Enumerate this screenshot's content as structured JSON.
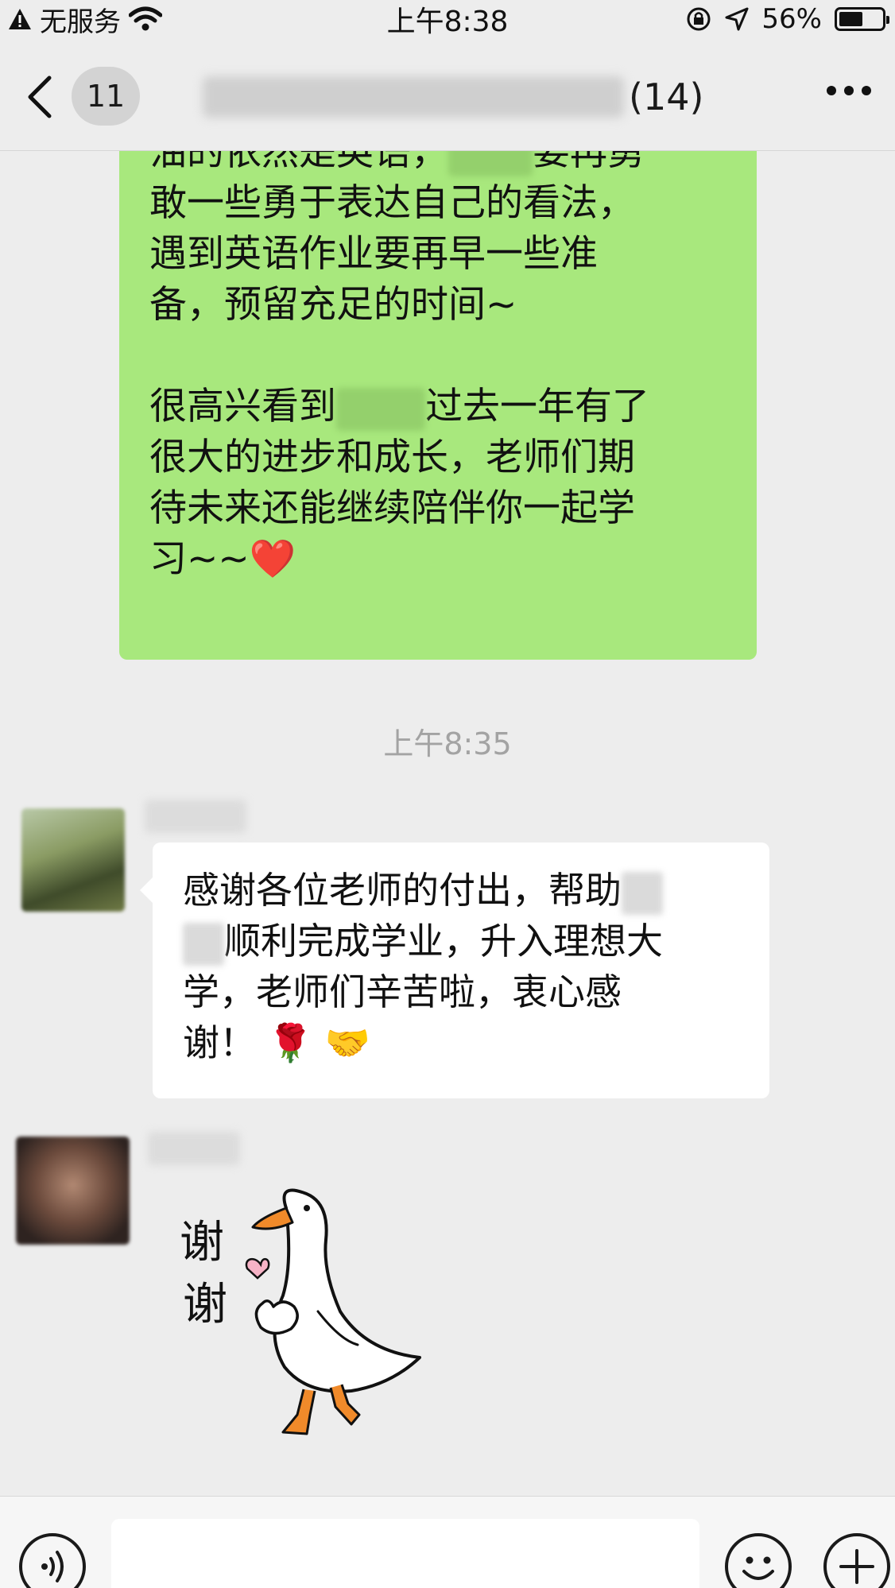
{
  "status_bar": {
    "carrier": "无服务",
    "time": "上午8:38",
    "battery_percent": "56%",
    "battery_level": 0.56
  },
  "nav": {
    "unread_count": "11",
    "member_count": "(14)"
  },
  "messages": {
    "green": {
      "lines": [
        "油的依然是英语，",
        "要再勇",
        "敢一些勇于表达自己的看法，",
        "遇到英语作业要再早一些准",
        "备，预留充足的时间~",
        "",
        "很高兴看到",
        "过去一年有了",
        "很大的进步和成长，老师们期",
        "待未来还能继续陪伴你一起学",
        "习~~"
      ],
      "heart_emoji": "❤️"
    },
    "timestamp": "上午8:35",
    "white": {
      "line1": "感谢各位老师的付出，帮助",
      "line2": "顺利完成学业，升入理想大",
      "line3": "学，老师们辛苦啦，衷心感",
      "line4": "谢！",
      "emojis": "🌹 🤝"
    },
    "sticker": {
      "text_top": "谢",
      "text_bottom": "谢"
    }
  },
  "colors": {
    "sent_bubble": "#a8e87d",
    "received_bubble": "#ffffff",
    "background": "#ededed"
  },
  "icons": [
    "warning-icon",
    "wifi-icon",
    "orientation-lock-icon",
    "location-icon",
    "battery-icon",
    "back-chevron-icon",
    "more-dots-icon",
    "voice-icon",
    "emoji-icon",
    "plus-icon"
  ]
}
